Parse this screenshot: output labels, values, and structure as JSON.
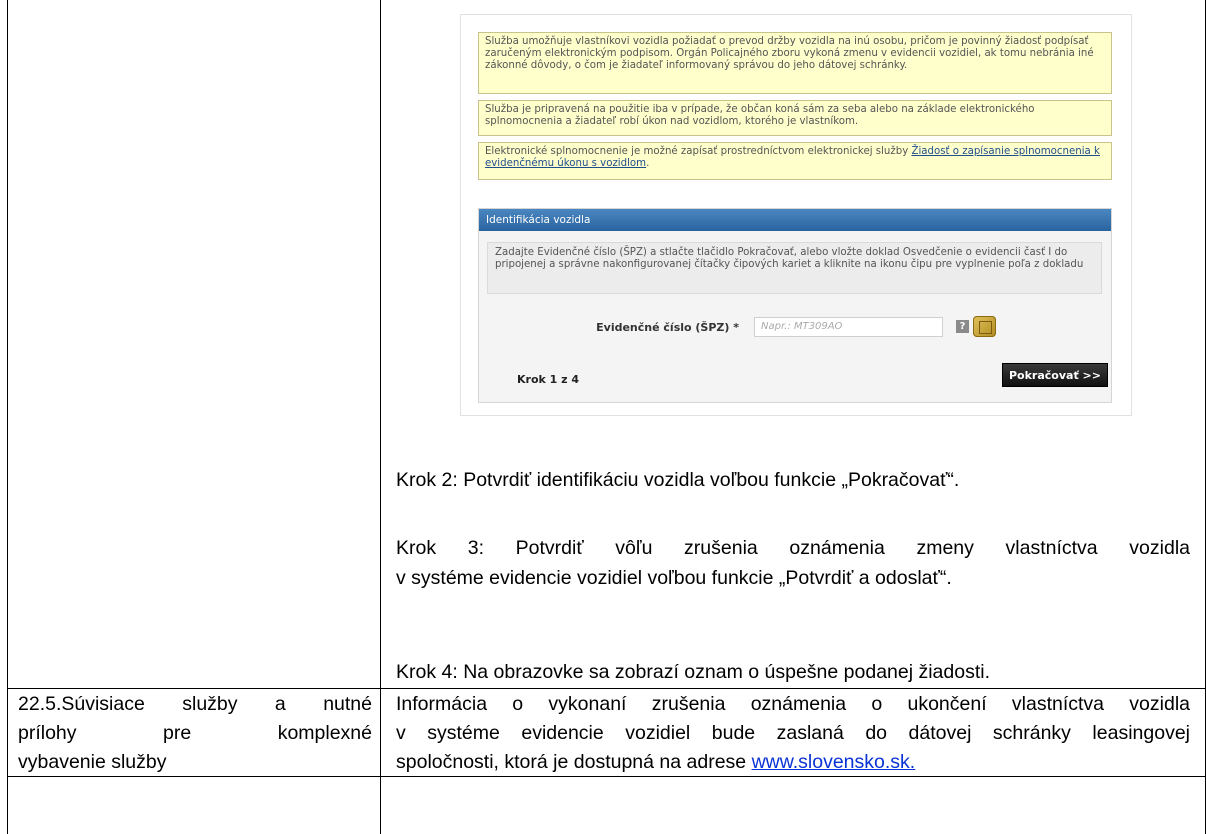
{
  "screenshot": {
    "note1": "Služba umožňuje vlastníkovi vozidla požiadať o prevod držby vozidla na inú osobu, pričom je povinný žiadosť podpísať zaručeným elektronickým podpisom. Orgán Policajného zboru vykoná zmenu v evidencii vozidiel, ak tomu nebránia iné zákonné dôvody, o čom je žiadateľ informovaný správou do jeho dátovej schránky.",
    "note2": "Služba je pripravená na použitie iba v prípade, že občan koná sám za seba alebo na základe elektronického splnomocnenia a žiadateľ robí úkon nad vozidlom, ktorého je vlastníkom.",
    "note3_text": "Elektronické splnomocnenie je možné zapísať prostredníctvom elektronickej služby ",
    "note3_link": "Žiadosť o zapísanie splnomocnenia k evidenčnému úkonu s vozidlom",
    "note3_end": ".",
    "panel_title": "Identifikácia vozidla",
    "panel_info": "Zadajte Evidenčné číslo (ŠPZ) a stlačte tlačidlo Pokračovať, alebo vložte doklad Osvedčenie o evidencii časť I do pripojenej a správne nakonfigurovanej čítačky čipových kariet a kliknite na ikonu čipu pre vyplnenie poľa z dokladu",
    "field_label": "Evidenčné číslo (ŠPZ) *",
    "field_placeholder": "Napr.: MT309AO",
    "help_glyph": "?",
    "step_label": "Krok 1 z 4",
    "next_button": "Pokračovať >>"
  },
  "steps": {
    "step2": "Krok 2: Potvrdiť identifikáciu vozidla voľbou funkcie „Pokračovať“.",
    "step3_line1": "Krok 3: Potvrdiť vôľu zrušenia oznámenia zmeny vlastníctva vozidla",
    "step3_line2": "v systéme evidencie vozidiel voľbou funkcie „Potvrdiť a odoslať“.",
    "step4": "Krok 4: Na obrazovke sa zobrazí oznam o úspešne podanej žiadosti."
  },
  "row_22_5": {
    "label_line1": "22.5.Súvisiace služby a nutné",
    "label_line2": "prílohy pre komplexné",
    "label_line3": "vybavenie služby",
    "info_line1": "Informácia o vykonaní zrušenia oznámenia o ukončení vlastníctva vozidla",
    "info_line2": "v systéme evidencie vozidiel bude zaslaná do dátovej schránky leasingovej",
    "info_line3_text": "spoločnosti, ktorá je dostupná na adrese ",
    "info_line3_link": "www.slovensko.sk."
  }
}
